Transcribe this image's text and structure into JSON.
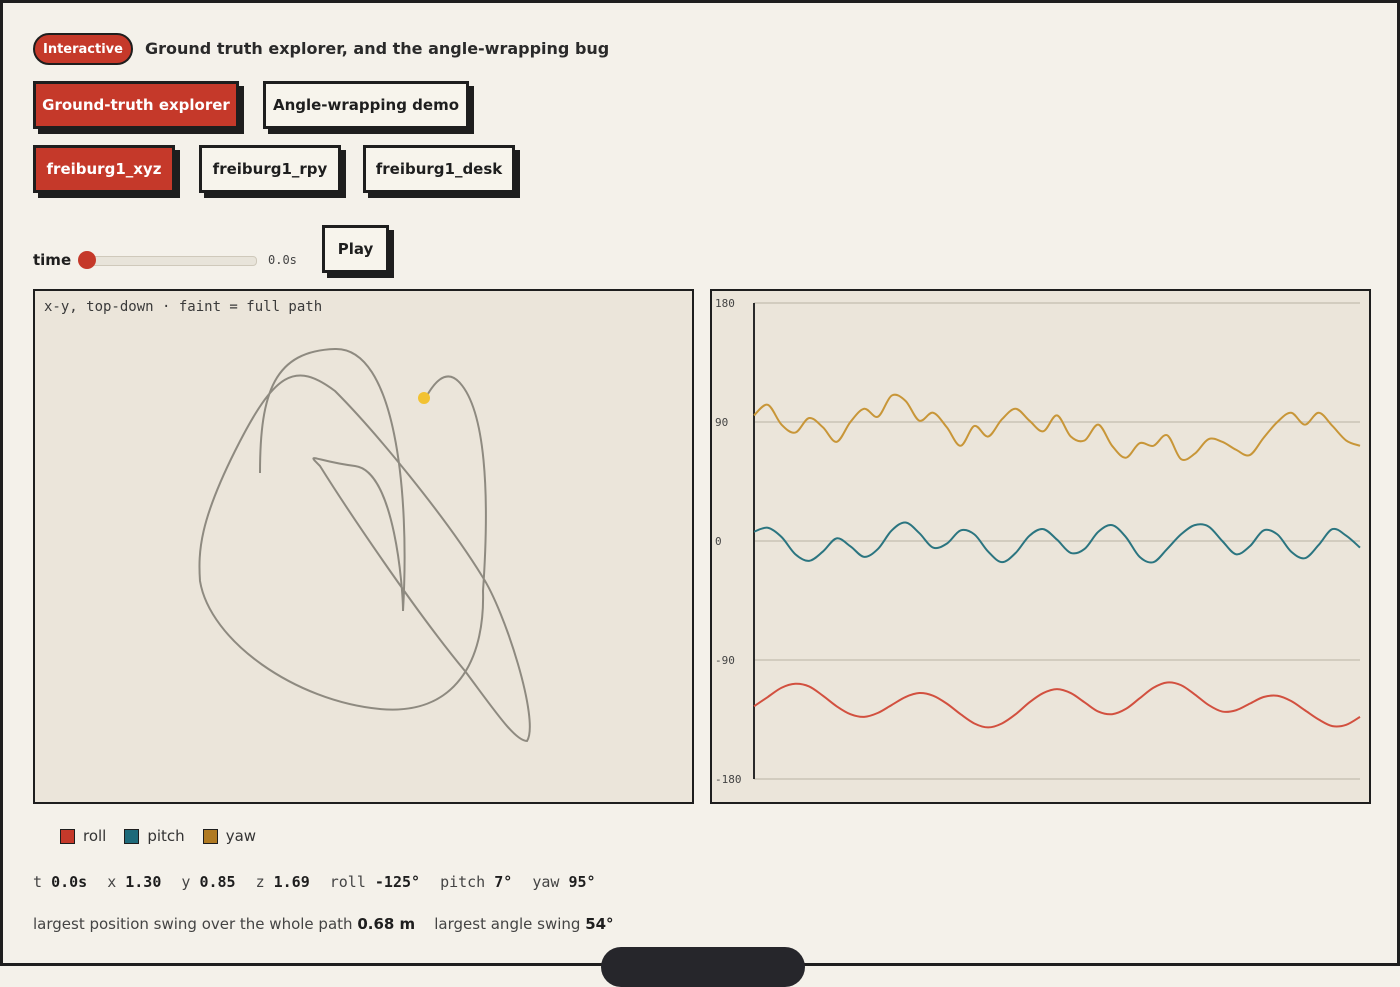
{
  "header": {
    "badge": "Interactive",
    "title": "Ground truth explorer, and the angle-wrapping bug"
  },
  "mode_tabs": [
    {
      "label": "Ground-truth explorer",
      "active": true
    },
    {
      "label": "Angle-wrapping demo",
      "active": false
    }
  ],
  "sequence_tabs": [
    {
      "label": "freiburg1_xyz",
      "active": true
    },
    {
      "label": "freiburg1_rpy",
      "active": false
    },
    {
      "label": "freiburg1_desk",
      "active": false
    }
  ],
  "time_control": {
    "label": "time",
    "value_text": "0.0s",
    "position_fraction": 0.0,
    "play_label": "Play"
  },
  "trajectory_panel": {
    "caption": "x-y, top-down · faint = full path",
    "current_marker_color": "#f2c232",
    "path_color": "#8e8a80"
  },
  "chart_data": {
    "type": "line",
    "yticks": [
      "180",
      "90",
      "0",
      "-90",
      "-180"
    ],
    "ylim": [
      -180,
      180
    ],
    "grid": true,
    "series": [
      {
        "name": "roll",
        "color": "#d2503f",
        "values": [
          -125,
          -118,
          -111,
          -108,
          -110,
          -117,
          -125,
          -131,
          -133,
          -130,
          -124,
          -118,
          -115,
          -117,
          -123,
          -131,
          -138,
          -141,
          -138,
          -131,
          -122,
          -115,
          -112,
          -115,
          -122,
          -129,
          -131,
          -127,
          -119,
          -111,
          -107,
          -109,
          -116,
          -124,
          -129,
          -128,
          -123,
          -118,
          -117,
          -121,
          -128,
          -135,
          -140,
          -139,
          -133
        ]
      },
      {
        "name": "pitch",
        "color": "#2b7580",
        "values": [
          7,
          10,
          3,
          -10,
          -15,
          -8,
          2,
          -4,
          -12,
          -6,
          8,
          14,
          6,
          -5,
          -2,
          8,
          5,
          -8,
          -16,
          -9,
          4,
          9,
          1,
          -9,
          -6,
          7,
          12,
          3,
          -12,
          -16,
          -6,
          5,
          12,
          11,
          0,
          -10,
          -4,
          8,
          5,
          -8,
          -13,
          -3,
          9,
          4,
          -5
        ]
      },
      {
        "name": "yaw",
        "color": "#c89638",
        "values": [
          95,
          103,
          88,
          82,
          93,
          86,
          75,
          90,
          100,
          94,
          110,
          106,
          91,
          97,
          86,
          72,
          87,
          79,
          92,
          100,
          91,
          83,
          95,
          79,
          76,
          88,
          72,
          63,
          74,
          72,
          80,
          62,
          66,
          77,
          75,
          69,
          65,
          78,
          90,
          97,
          88,
          97,
          87,
          76,
          72
        ]
      }
    ]
  },
  "legend": [
    {
      "label": "roll",
      "color": "#c5392a"
    },
    {
      "label": "pitch",
      "color": "#1e6a7a"
    },
    {
      "label": "yaw",
      "color": "#b07a22"
    }
  ],
  "readout": {
    "t_label": "t",
    "t_value": "0.0s",
    "x_label": "x",
    "x_value": "1.30",
    "y_label": "y",
    "y_value": "0.85",
    "z_label": "z",
    "z_value": "1.69",
    "roll_label": "roll",
    "roll_value": "-125°",
    "pitch_label": "pitch",
    "pitch_value": "7°",
    "yaw_label": "yaw",
    "yaw_value": "95°"
  },
  "summary": {
    "position_label": "largest position swing over the whole path",
    "position_value": "0.68 m",
    "angle_label": "largest angle swing",
    "angle_value": "54°"
  }
}
